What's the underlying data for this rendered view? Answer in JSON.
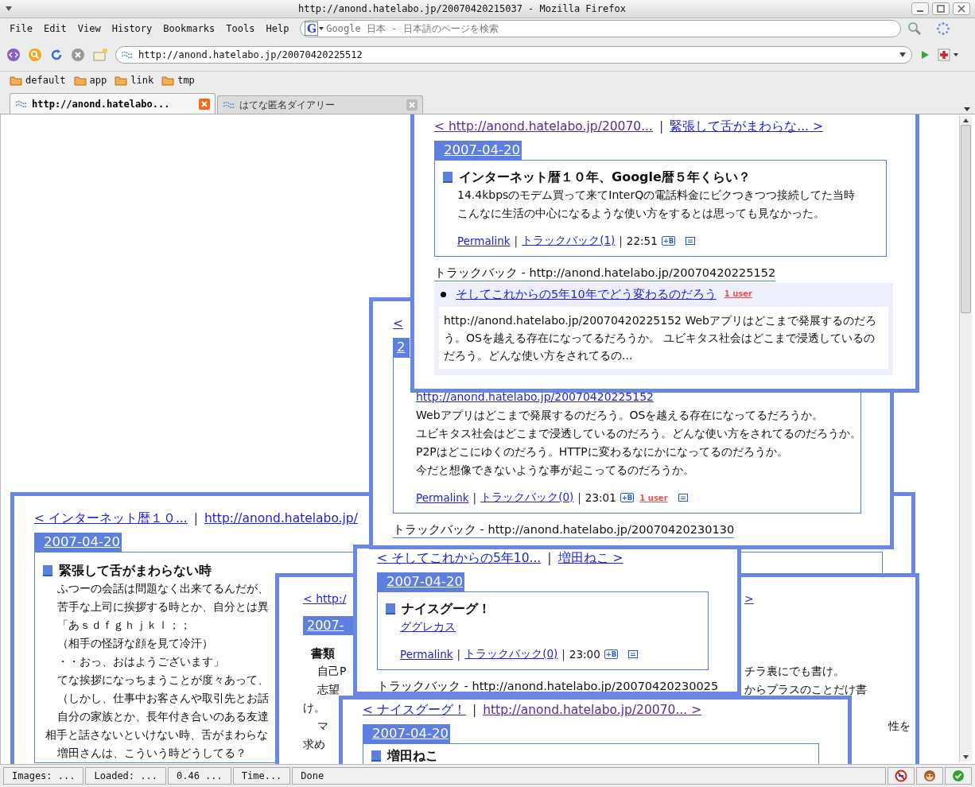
{
  "window": {
    "title": "http://anond.hatelabo.jp/20070420215037 - Mozilla Firefox"
  },
  "menu": [
    "File",
    "Edit",
    "View",
    "History",
    "Bookmarks",
    "Tools",
    "Help"
  ],
  "search": {
    "engine_letter": "G",
    "placeholder": "Google 日本 - 日本語のページを検索"
  },
  "address": {
    "value": "http://anond.hatelabo.jp/20070420225512"
  },
  "bookmarks": [
    "default",
    "app",
    "link",
    "tmp"
  ],
  "tabs": [
    {
      "label": "http://anond.hatelabo...",
      "selected": true
    },
    {
      "label": "はてな匿名ダイアリー",
      "selected": false
    }
  ],
  "popups": [
    {
      "blocks": [
        {
          "kind": "nav",
          "prev": {
            "text": "< http://anond.hatelabo.jp/20070...",
            "visited": true
          },
          "separator": "|",
          "next": {
            "text": "緊張して舌がまわらな... >",
            "visited": false
          }
        },
        {
          "kind": "date",
          "text": "2007-04-20"
        },
        {
          "kind": "entry",
          "title": "インターネット暦１０年、Google暦５年くらい？",
          "lines": [
            {
              "kind": "text",
              "text": "14.4kbpsのモデム買って来てInterQの電話料金にビクつきつつ接続してた当時"
            },
            {
              "kind": "text",
              "text": "こんなに生活の中心になるような使い方をするとは思っても見なかった。"
            }
          ],
          "footer": [
            {
              "kind": "link",
              "text": "Permalink"
            },
            {
              "kind": "sep",
              "text": "|"
            },
            {
              "kind": "link",
              "text": "トラックバック(1)"
            },
            {
              "kind": "sep",
              "text": "|"
            },
            {
              "kind": "text",
              "text": "22:51"
            },
            {
              "kind": "hatena",
              "text": "+B"
            },
            {
              "kind": "comment"
            }
          ]
        },
        {
          "kind": "tb_heading",
          "text": "トラックバック - http://anond.hatelabo.jp/20070420225152"
        },
        {
          "kind": "tb_item",
          "title": "そしてこれからの5年10年でどう変わるのだろう",
          "users": "1 user",
          "excerpt": "http://anond.hatelabo.jp/20070420225152 Webアプリはどこまで発展するのだろう。OSを越える存在になってるだろうか。 ユビキタス社会はどこまで浸透しているのだろう。どんな使い方をされてるの..."
        }
      ]
    },
    {
      "blocks": [
        {
          "kind": "nav",
          "prev": {
            "text": "<",
            "visited": false
          }
        },
        {
          "kind": "date",
          "text": "2"
        },
        {
          "kind": "entry",
          "lines": [
            {
              "kind": "link",
              "text": "http://anond.hatelabo.jp/20070420225152"
            },
            {
              "kind": "text",
              "text": "Webアプリはどこまで発展するのだろう。OSを越える存在になってるだろうか。"
            },
            {
              "kind": "text",
              "text": "ユビキタス社会はどこまで浸透しているのだろう。どんな使い方をされてるのだろうか。"
            },
            {
              "kind": "text",
              "text": "P2Pはどこにゆくのだろう。HTTPに変わるなにかになってるのだろうか。"
            },
            {
              "kind": "text",
              "text": "今だと想像できないような事が起こってるのだろうか。"
            }
          ],
          "footer": [
            {
              "kind": "link",
              "text": "Permalink"
            },
            {
              "kind": "sep",
              "text": "|"
            },
            {
              "kind": "link",
              "text": "トラックバック(0)"
            },
            {
              "kind": "sep",
              "text": "|"
            },
            {
              "kind": "text",
              "text": "23:01"
            },
            {
              "kind": "hatena",
              "text": "+B"
            },
            {
              "kind": "users",
              "text": "1 user"
            },
            {
              "kind": "comment"
            }
          ]
        },
        {
          "kind": "tb_heading",
          "text": "トラックバック - http://anond.hatelabo.jp/20070420230130"
        }
      ]
    },
    {
      "blocks": [
        {
          "kind": "nav",
          "prev": {
            "text": "< インターネット暦１０...",
            "visited": false
          },
          "separator": "|",
          "next": {
            "text": "http://anond.hatelabo.jp/",
            "visited": false
          }
        },
        {
          "kind": "date",
          "text": "2007-04-20"
        },
        {
          "kind": "entry",
          "title": "緊張して舌がまわらない時",
          "lines": [
            {
              "kind": "text",
              "text": "ふつーの会話は問題なく出来てるんだが、"
            },
            {
              "kind": "text",
              "text": "苦手な上司に挨拶する時とか、自分とは異"
            },
            {
              "kind": "text",
              "text": "「あｓｄｆｇｈｊｋｌ；；"
            },
            {
              "kind": "text",
              "text": "（相手の怪訝な顔を見て冷汗）"
            },
            {
              "kind": "text",
              "text": "・・おっ、おはようございます」"
            },
            {
              "kind": "text",
              "text": "てな挨拶になっちまうことが度々あって、"
            },
            {
              "kind": "text",
              "text": "（しかし、仕事中お客さんや取引先とお話"
            },
            {
              "kind": "text",
              "text": "自分の家族とか、長年付き合いのある友達"
            },
            {
              "kind": "flush",
              "text": "相手と話さないといけない時、舌がまわらな"
            },
            {
              "kind": "text",
              "text": "増田さんは、こういう時どうしてる？"
            }
          ]
        }
      ]
    },
    {
      "blocks": [
        {
          "kind": "nav",
          "prev": {
            "text": "< そしてこれからの5年10...",
            "visited": false
          },
          "separator": "|",
          "next": {
            "text": "増田ねこ >",
            "visited": false
          }
        },
        {
          "kind": "date",
          "text": "2007-04-20"
        },
        {
          "kind": "entry",
          "title": "ナイスグーグ！",
          "lines": [
            {
              "kind": "link",
              "text": "ググレカス"
            }
          ],
          "footer": [
            {
              "kind": "link",
              "text": "Permalink"
            },
            {
              "kind": "sep",
              "text": "|"
            },
            {
              "kind": "link",
              "text": "トラックバック(0)"
            },
            {
              "kind": "sep",
              "text": "|"
            },
            {
              "kind": "text",
              "text": "23:00"
            },
            {
              "kind": "hatena",
              "text": "+B"
            },
            {
              "kind": "comment"
            }
          ]
        },
        {
          "kind": "tb_heading",
          "text": "トラックバック - http://anond.hatelabo.jp/20070420230025"
        }
      ]
    },
    {
      "blocks": [
        {
          "kind": "fragments",
          "left": [
            {
              "kind": "link",
              "text": "< http:/"
            },
            {
              "kind": "date",
              "text": "2007-"
            },
            {
              "kind": "title",
              "text": "書類"
            },
            {
              "kind": "text",
              "text": "自己P"
            },
            {
              "kind": "text",
              "text": "志望"
            },
            {
              "kind": "flush",
              "text": "け。"
            },
            {
              "kind": "text",
              "text": "マ"
            },
            {
              "kind": "flush",
              "text": "求め"
            }
          ],
          "right": [
            {
              "kind": "link",
              "text": ">"
            },
            {
              "kind": "text",
              "text": "チラ裏にでも書け。"
            },
            {
              "kind": "text",
              "text": "からプラスのことだけ書"
            },
            {
              "kind": "text",
              "text": "性を"
            }
          ]
        }
      ]
    },
    {
      "blocks": [
        {
          "kind": "nav",
          "prev": {
            "text": "< ナイスグーグ！",
            "visited": false
          },
          "separator": "|",
          "next": {
            "text": "http://anond.hatelabo.jp/20070... >",
            "visited": true
          }
        },
        {
          "kind": "date",
          "text": "2007-04-20"
        },
        {
          "kind": "entry",
          "title": "増田ねこ"
        }
      ]
    }
  ],
  "status_bar": [
    "Images: ...",
    "Loaded: ...",
    "0.46 ...",
    "Time...",
    "Done"
  ]
}
